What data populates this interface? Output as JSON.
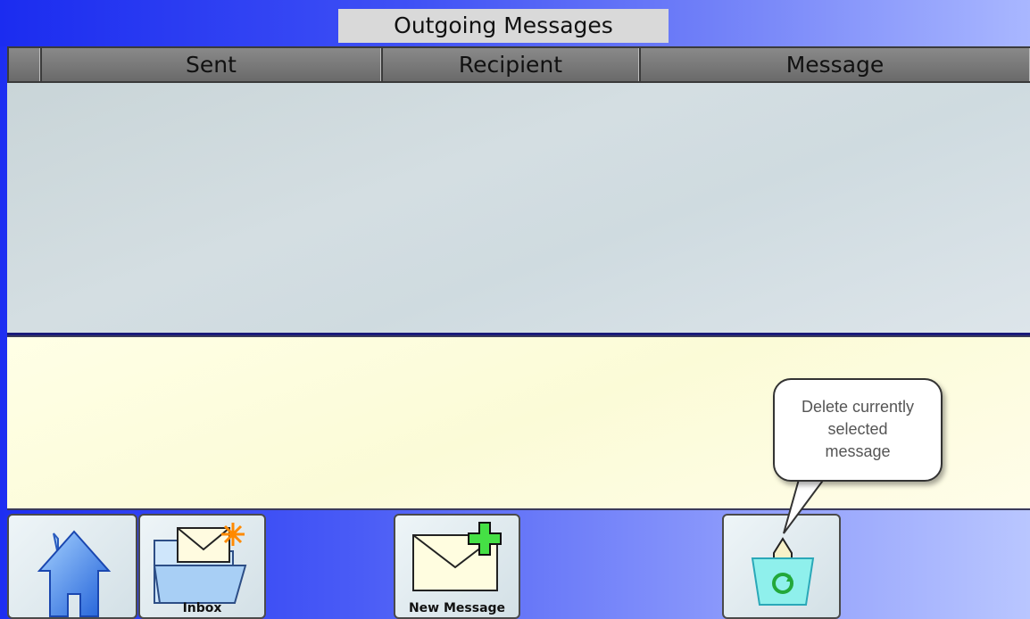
{
  "window": {
    "title": "Outgoing Messages"
  },
  "table": {
    "columns": [
      "",
      "Sent",
      "Recipient",
      "Message"
    ],
    "rows": []
  },
  "toolbar": {
    "home_label": "",
    "inbox_label": "Inbox",
    "new_message_label": "New Message",
    "delete_label": ""
  },
  "callout": {
    "line1": "Delete currently",
    "line2": "selected",
    "line3": "message"
  },
  "icons": {
    "home": "home-icon",
    "inbox": "inbox-folder-icon",
    "new_message": "new-message-icon",
    "delete": "recycle-bin-icon"
  }
}
